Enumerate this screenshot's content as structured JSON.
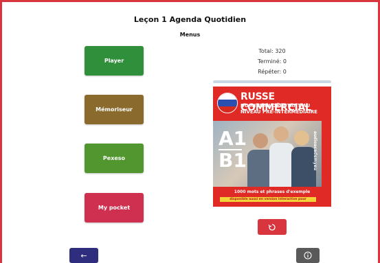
{
  "header": {
    "title": "Leçon 1 Agenda Quotidien",
    "subtitle": "Menus"
  },
  "menu": {
    "items": [
      {
        "label": "Player",
        "color": "#2f8f3a"
      },
      {
        "label": "Mémoriseur",
        "color": "#8a6a2d"
      },
      {
        "label": "Pexeso",
        "color": "#52962f"
      },
      {
        "label": "My pocket",
        "color": "#d0304f"
      }
    ]
  },
  "stats": {
    "total": "Total: 320",
    "done": "Terminé: 0",
    "repeat": "Répéter: 0"
  },
  "cover": {
    "title": "RUSSE COMMERCIAL",
    "line2": "DU NIVEAU DÉBUTANT AU",
    "line3": "NIVEAU PRÉ-INTERMÉDIAIRE",
    "level1": "A1",
    "level2": "B1",
    "brand": "audioacademyeu",
    "footer": "1000 mots et phrases d'exemple",
    "banner": "disponible aussi en version interactive pour"
  },
  "actions": {
    "refresh_icon": "refresh-icon",
    "back_icon": "arrow-left-icon",
    "back_symbol": "←",
    "info_icon": "info-icon"
  }
}
